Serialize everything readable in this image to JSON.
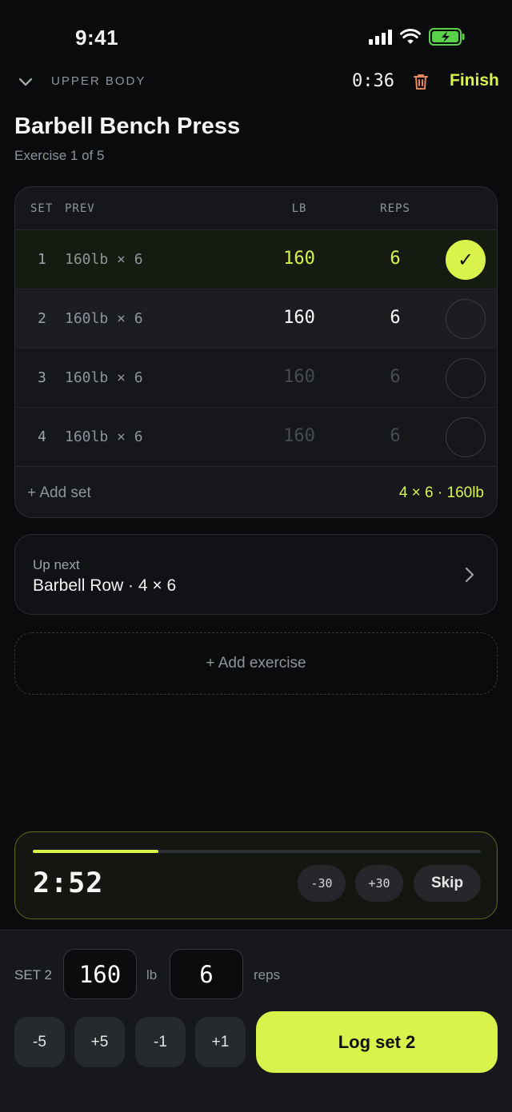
{
  "status_bar": {
    "time": "9:41"
  },
  "header": {
    "workout_name": "UPPER BODY",
    "elapsed": "0:36",
    "finish_label": "Finish"
  },
  "exercise": {
    "title": "Barbell Bench Press",
    "subtitle": "Exercise 1 of 5"
  },
  "sets_table": {
    "headers": {
      "set": "SET",
      "prev": "PREV",
      "lb": "LB",
      "reps": "REPS"
    },
    "rows": [
      {
        "num": "1",
        "prev": "160lb × 6",
        "lb": "160",
        "reps": "6",
        "state": "done",
        "check": "✓"
      },
      {
        "num": "2",
        "prev": "160lb × 6",
        "lb": "160",
        "reps": "6",
        "state": "active",
        "check": ""
      },
      {
        "num": "3",
        "prev": "160lb × 6",
        "lb": "160",
        "reps": "6",
        "state": "pending",
        "check": ""
      },
      {
        "num": "4",
        "prev": "160lb × 6",
        "lb": "160",
        "reps": "6",
        "state": "pending",
        "check": ""
      }
    ],
    "add_set_label": "+ Add set",
    "summary": "4 × 6 · 160lb"
  },
  "up_next": {
    "label": "Up next",
    "value": "Barbell Row · 4 × 6"
  },
  "add_exercise_label": "+ Add exercise",
  "rest_timer": {
    "time": "2:52",
    "progress": 0.28,
    "minus_label": "-30",
    "plus_label": "+30",
    "skip_label": "Skip"
  },
  "logger": {
    "set_label": "SET 2",
    "weight": "160",
    "weight_unit": "lb",
    "reps": "6",
    "reps_unit": "reps",
    "steppers": [
      "-5",
      "+5",
      "-1",
      "+1"
    ],
    "log_label": "Log set 2"
  },
  "colors": {
    "accent": "#d9f24c",
    "background": "#0a0b0d",
    "danger": "#e8875a"
  },
  "icons": [
    "chevron-down-icon",
    "trash-icon",
    "chevron-right-icon",
    "signal-icon",
    "wifi-icon",
    "battery-icon"
  ]
}
